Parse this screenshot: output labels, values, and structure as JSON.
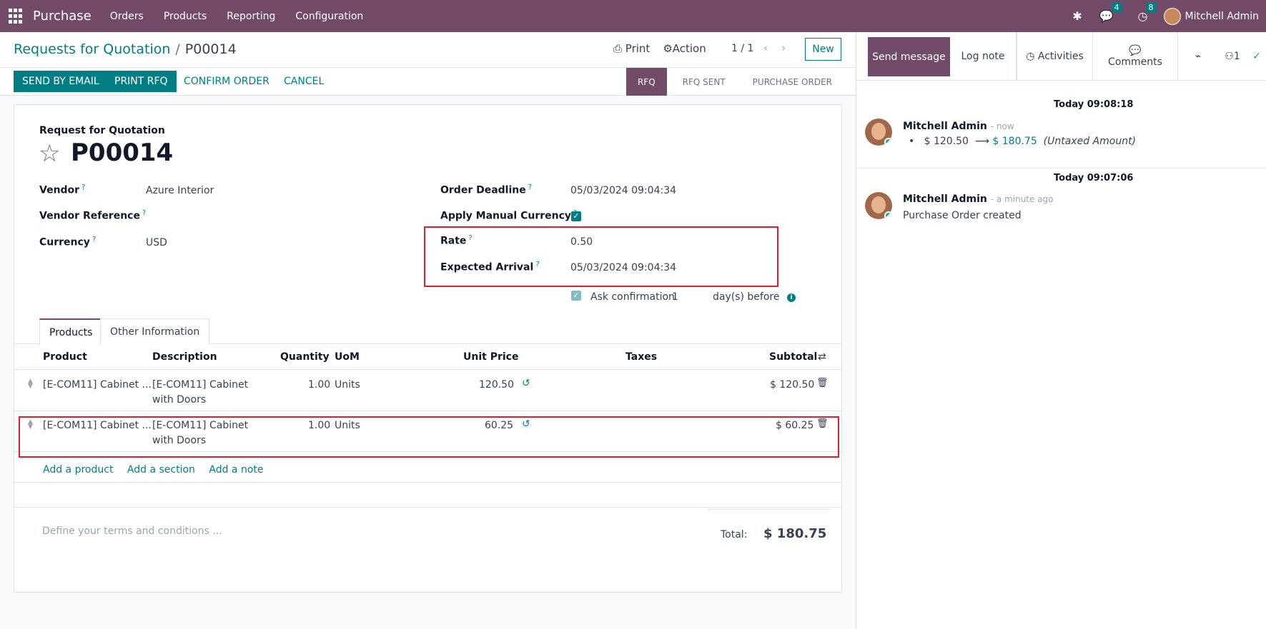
{
  "navbar": {
    "app_name": "Purchase",
    "menu": [
      "Orders",
      "Products",
      "Reporting",
      "Configuration"
    ],
    "messages_badge": "4",
    "activities_badge": "8",
    "user": "Mitchell Admin"
  },
  "control": {
    "breadcrumb_parent": "Requests for Quotation",
    "breadcrumb_sep": "/",
    "breadcrumb_current": "P00014",
    "print_label": "Print",
    "action_label": "Action",
    "pager": "1 / 1",
    "new_label": "New"
  },
  "statusbar": {
    "send_email": "SEND BY EMAIL",
    "print_rfq": "PRINT RFQ",
    "confirm": "CONFIRM ORDER",
    "cancel": "CANCEL",
    "stages": [
      "RFQ",
      "RFQ SENT",
      "PURCHASE ORDER"
    ]
  },
  "form": {
    "doc_type": "Request for Quotation",
    "doc_name": "P00014",
    "vendor_label": "Vendor",
    "vendor": "Azure Interior",
    "vendor_ref_label": "Vendor Reference",
    "currency_label": "Currency",
    "currency": "USD",
    "deadline_label": "Order Deadline",
    "deadline": "05/03/2024 09:04:34",
    "manual_currency_label": "Apply Manual Currency",
    "rate_label": "Rate",
    "rate": "0.50",
    "arrival_label": "Expected Arrival",
    "arrival": "05/03/2024 09:04:34",
    "ask_confirmation": "Ask confirmation",
    "ask_days": "1",
    "days_before": "day(s) before",
    "help_mark": "?"
  },
  "tabs": [
    "Products",
    "Other Information"
  ],
  "table": {
    "headers": [
      "Product",
      "Description",
      "Quantity",
      "UoM",
      "Unit Price",
      "Taxes",
      "Subtotal"
    ],
    "rows": [
      {
        "product": "[E-COM11] Cabinet ...",
        "desc1": "[E-COM11] Cabinet",
        "desc2": "with Doors",
        "qty": "1.00",
        "uom": "Units",
        "price": "120.50",
        "taxes": "",
        "subtotal": "$ 120.50"
      },
      {
        "product": "[E-COM11] Cabinet ...",
        "desc1": "[E-COM11] Cabinet",
        "desc2": "with Doors",
        "qty": "1.00",
        "uom": "Units",
        "price": "60.25",
        "taxes": "",
        "subtotal": "$ 60.25"
      }
    ],
    "add_product": "Add a product",
    "add_section": "Add a section",
    "add_note": "Add a note"
  },
  "footer": {
    "terms_placeholder": "Define your terms and conditions ...",
    "total_label": "Total:",
    "total": "$ 180.75"
  },
  "chatter": {
    "send_message": "Send message",
    "log_note": "Log note",
    "activities": "Activities",
    "comments": "Comments",
    "followers_count": "1",
    "messages": [
      {
        "date": "Today 09:08:18",
        "author": "Mitchell Admin",
        "time": "- now",
        "old_value": "$ 120.50",
        "arrow": "⟶",
        "new_value": "$ 180.75",
        "field": "(Untaxed Amount)"
      },
      {
        "date": "Today 09:07:06",
        "author": "Mitchell Admin",
        "time": "- a minute ago",
        "body": "Purchase Order created"
      }
    ]
  },
  "colors": {
    "brand": "#714b67",
    "accent": "#017e84",
    "highlight": "#e11d2e"
  }
}
